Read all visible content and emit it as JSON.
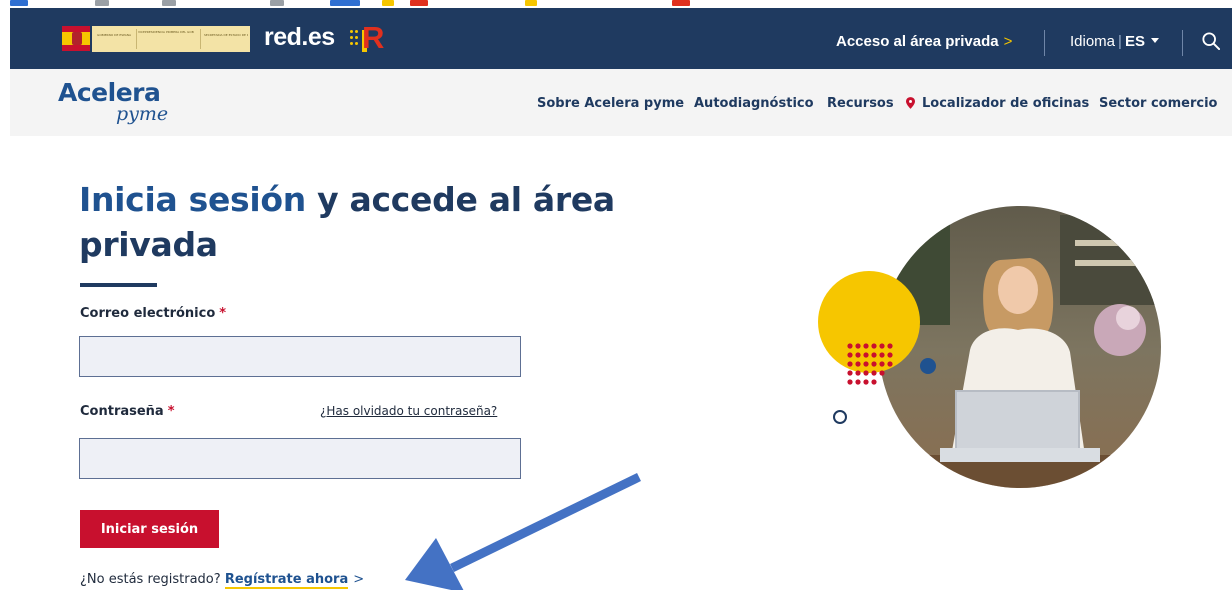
{
  "header": {
    "brand": "red.es",
    "private_area_label": "Acceso al área privada",
    "private_area_chevron": ">",
    "language_label": "Idioma",
    "language_separator": "|",
    "language_code": "ES",
    "gov_text_1": "GOBIERNO DE ESPAÑA",
    "gov_text_2": "VICEPRESIDENCIA PRIMERA DEL GOBIERNO MINISTERIO DE ASUNTOS ECONÓMICOS Y TRANSFORMACIÓN DIGITAL",
    "gov_text_3": "SECRETARÍA DE ESTADO DE DIGITALIZACIÓN E INTELIGENCIA ARTIFICIAL"
  },
  "nav": {
    "logo_main": "Acelera",
    "logo_sub": "pyme",
    "items": [
      {
        "label": "Sobre Acelera pyme"
      },
      {
        "label": "Autodiagnóstico"
      },
      {
        "label": "Recursos"
      },
      {
        "label": "Localizador de oficinas"
      },
      {
        "label": "Sector comercio"
      }
    ]
  },
  "main": {
    "title_accent": "Inicia sesión",
    "title_rest": " y accede al área privada",
    "email_label": "Correo electrónico",
    "email_value": "",
    "password_label": "Contraseña",
    "password_value": "",
    "required_mark": "*",
    "forgot_link": "¿Has olvidado tu contraseña?",
    "login_button": "Iniciar sesión",
    "register_prompt": "¿No estás registrado?",
    "register_link": "Regístrate ahora",
    "register_chevron": ">"
  },
  "colors": {
    "topbar": "#1f3a60",
    "brand_blue": "#1f5290",
    "accent_red": "#c8102e",
    "accent_yellow": "#f6c600",
    "annotation_arrow": "#4472c4"
  },
  "icons": {
    "search": "search-icon",
    "location_pin": "location-pin-icon",
    "dropdown": "caret-down-icon"
  }
}
